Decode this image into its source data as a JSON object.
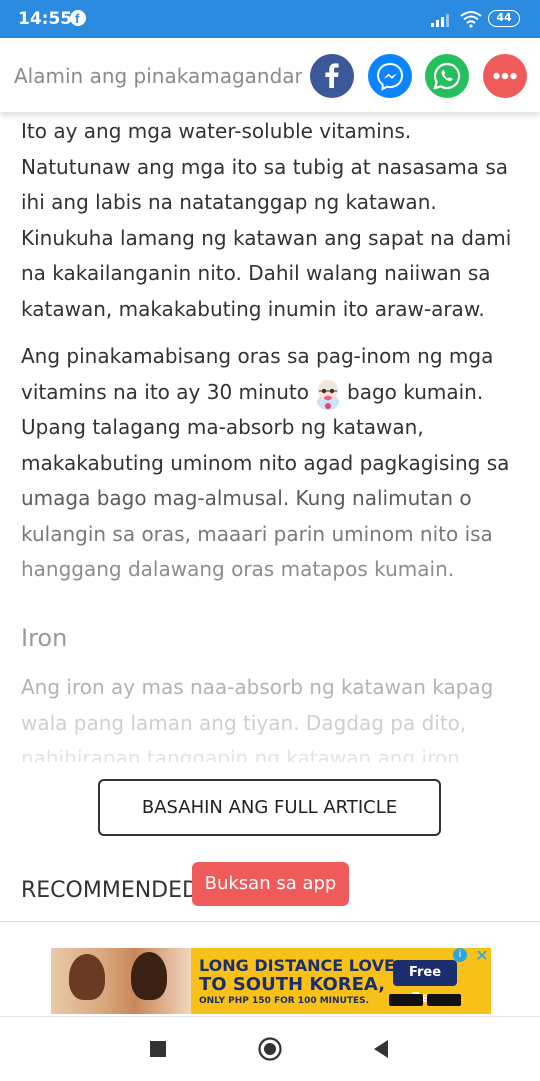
{
  "status_bar": {
    "time": "14:55",
    "battery": "44"
  },
  "share_header": {
    "title": "Alamin ang pinakamagandang oras ng pag-inom ng vitamins",
    "buttons": [
      {
        "label": "Facebook",
        "icon": "facebook-icon",
        "color": "#3b5998"
      },
      {
        "label": "Messenger",
        "icon": "messenger-icon",
        "color": "#0a84ff"
      },
      {
        "label": "WhatsApp",
        "icon": "whatsapp-icon",
        "color": "#25c05b"
      },
      {
        "label": "More",
        "icon": "more-icon",
        "color": "#ef5b5b"
      }
    ]
  },
  "article": {
    "p1": [
      "Ito ay ang mga water-soluble vitamins.",
      "Natutunaw ang mga ito sa tubig at nasasama sa",
      "ihi ang labis na natatanggap ng katawan.",
      "Kinukuha lamang ng katawan ang sapat na dami",
      "na kakailanganin nito. Dahil walang naiiwan sa",
      "katawan, makakabuting inumin ito araw-araw."
    ],
    "p2": {
      "line1": "Ang pinakamabisang oras sa pag-inom ng mga",
      "line2_before": "vitamins na ito ay 30 minuto",
      "line2_after": "bago kumain.",
      "lines": [
        "Upang talagang ma-absorb ng katawan,",
        "makakabuting uminom nito agad pagkagising sa",
        "umaga bago mag-almusal. Kung nalimutan o",
        "kulangin sa oras, maaari parin uminom nito isa",
        "hanggang dalawang oras matapos kumain."
      ]
    },
    "iron_heading": "Iron",
    "iron_lines": [
      "Ang iron ay mas naa-absorb ng katawan kapag",
      "wala pang laman ang tiyan. Dagdag pa dito,",
      "nahihirapan tanggapin ng katawan ang iron"
    ]
  },
  "full_article_label": "BASAHIN ANG FULL ARTICLE",
  "recommended_label": "RECOMMENDED",
  "open_app_label": "Buksan sa app",
  "ad": {
    "line1": "LONG DISTANCE LOVE",
    "line2": "TO SOUTH KOREA,",
    "line3": "ONLY PHP 150 FOR 100 MINUTES.",
    "brand": "Free Bee",
    "info": "i",
    "close": "✕"
  }
}
